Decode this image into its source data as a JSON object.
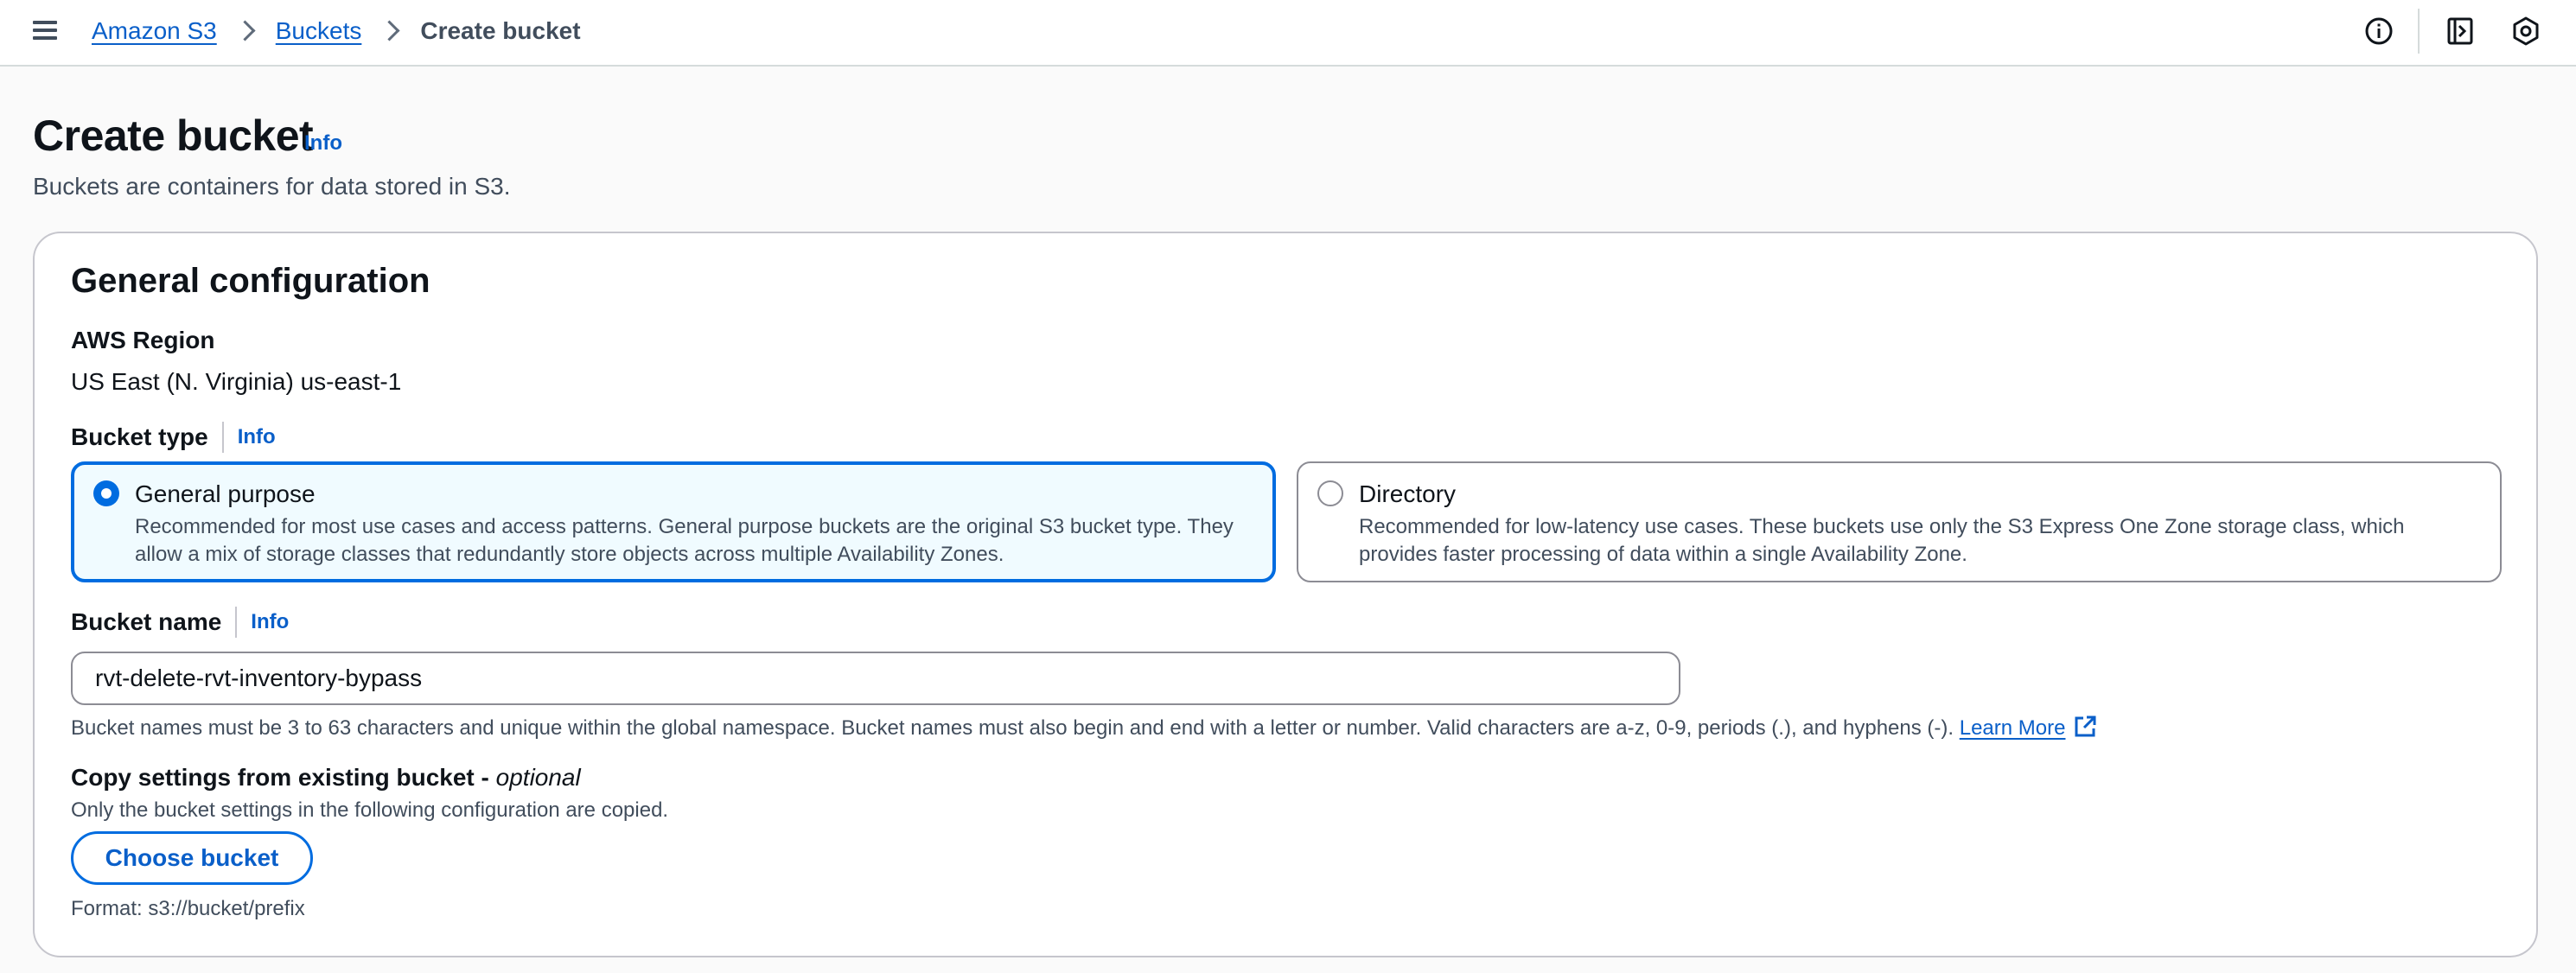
{
  "breadcrumb": {
    "root": "Amazon S3",
    "parent": "Buckets",
    "current": "Create bucket"
  },
  "header": {
    "title": "Create bucket",
    "info": "Info",
    "description": "Buckets are containers for data stored in S3."
  },
  "general": {
    "title": "General configuration",
    "region_label": "AWS Region",
    "region_value": "US East (N. Virginia) us-east-1",
    "bucket_type_label": "Bucket type",
    "bucket_type_info": "Info",
    "types": [
      {
        "title": "General purpose",
        "desc_line1": "Recommended for most use cases and access patterns. General purpose buckets are the original S3 bucket type. They",
        "desc_line2": "allow a mix of storage classes that redundantly store objects across multiple Availability Zones.",
        "selected": true
      },
      {
        "title": "Directory",
        "desc_line1": "Recommended for low-latency use cases. These buckets use only the S3 Express One Zone storage class, which",
        "desc_line2": "provides faster processing of data within a single Availability Zone.",
        "selected": false
      }
    ],
    "bucket_name_label": "Bucket name",
    "bucket_name_info": "Info",
    "bucket_name_value": "rvt-delete-rvt-inventory-bypass",
    "bucket_name_hint": "Bucket names must be 3 to 63 characters and unique within the global namespace. Bucket names must also begin and end with a letter or number. Valid characters are a-z, 0-9, periods (.), and hyphens (-).",
    "learn_more": "Learn More",
    "copy_label": "Copy settings from existing bucket - ",
    "copy_optional": "optional",
    "copy_desc": "Only the bucket settings in the following configuration are copied.",
    "choose_bucket": "Choose bucket",
    "format_hint": "Format: s3://bucket/prefix"
  },
  "icons": {
    "menu": "hamburger-menu-icon",
    "info": "info-circle-icon",
    "notifications": "side-panel-icon",
    "settings": "settings-hexagon-icon",
    "external": "external-link-icon"
  },
  "colors": {
    "accent": "#006ce0",
    "link": "#0a5fc9",
    "selected_bg": "#f0fbff"
  }
}
